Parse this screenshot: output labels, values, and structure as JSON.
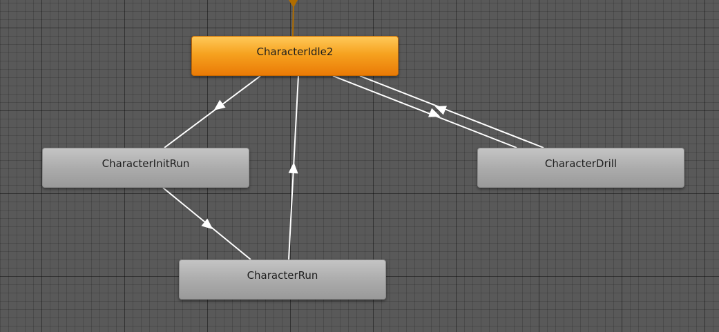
{
  "states": {
    "idle2": {
      "label": "CharacterIdle2"
    },
    "initrun": {
      "label": "CharacterInitRun"
    },
    "drill": {
      "label": "CharacterDrill"
    },
    "run": {
      "label": "CharacterRun"
    }
  },
  "transitions": [
    {
      "from": "idle2",
      "to": "initrun"
    },
    {
      "from": "initrun",
      "to": "run"
    },
    {
      "from": "run",
      "to": "idle2"
    },
    {
      "from": "idle2",
      "to": "drill"
    },
    {
      "from": "drill",
      "to": "idle2"
    }
  ],
  "colors": {
    "canvas_background": "#595959",
    "default_state": "#f6a21f",
    "normal_state": "#aaaaaa",
    "transition_line": "#ffffff",
    "entry_line": "#b06d00"
  }
}
